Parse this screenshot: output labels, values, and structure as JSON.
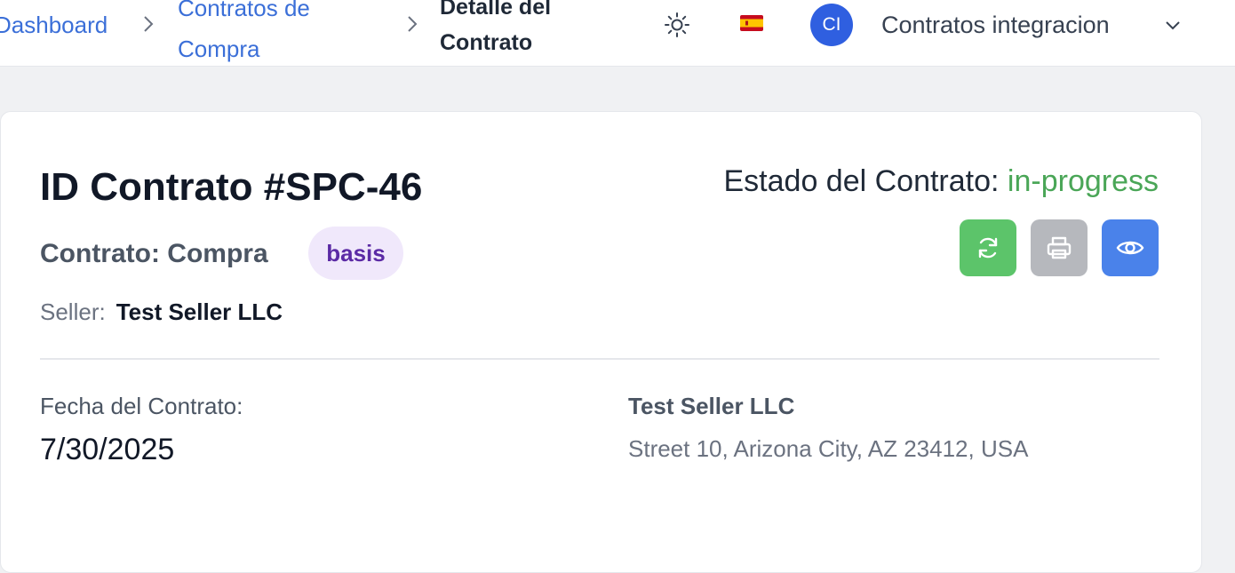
{
  "breadcrumb": {
    "items": [
      "Dashboard",
      "Contratos de Compra"
    ],
    "current_line1": "Detalle del",
    "current_line2": "Contrato",
    "contratos_line1": "Contratos de",
    "contratos_line2": "Compra"
  },
  "topbar": {
    "theme_icon": "sun-icon",
    "language_flag": "🇪🇸",
    "avatar_initials": "CI",
    "user_name": "Contratos integracion",
    "menu_icon": "chevron-down-icon"
  },
  "contract": {
    "title": "ID Contrato #SPC-46",
    "status_label": "Estado del Contrato:",
    "status_value": "in-progress",
    "type_text": "Contrato: Compra",
    "badge": "basis",
    "seller_label": "Seller:",
    "seller_value": "Test Seller LLC",
    "date_label": "Fecha del Contrato:",
    "date_value": "7/30/2025",
    "party_name": "Test Seller LLC",
    "party_address": "Street 10, Arizona City, AZ 23412, USA"
  },
  "actions": {
    "refresh_icon": "refresh-icon",
    "print_icon": "printer-icon",
    "view_icon": "eye-icon"
  },
  "colors": {
    "link": "#3b6fd8",
    "status_green": "#4aa657",
    "refresh_button": "#5cc46a",
    "print_button": "#b6b8bd",
    "view_button": "#4a82ea",
    "badge_bg": "#f0e8fb",
    "badge_text": "#5b2aa5"
  }
}
